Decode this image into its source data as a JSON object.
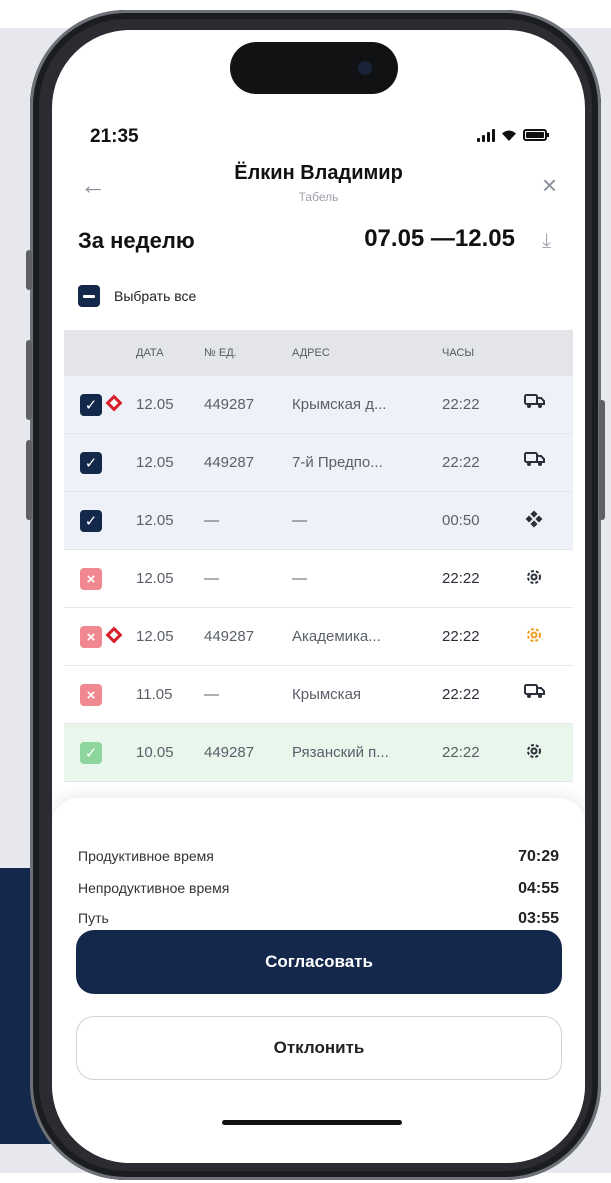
{
  "status": {
    "time": "21:35"
  },
  "header": {
    "title": "Ёлкин Владимир",
    "subtitle": "Табель"
  },
  "period": {
    "label": "За неделю",
    "range": "07.05 —12.05"
  },
  "select_all": {
    "label": "Выбрать все"
  },
  "table": {
    "columns": [
      "ДАТА",
      "№ ЕД.",
      "АДРЕС",
      "ЧАСЫ"
    ],
    "rows": [
      {
        "status": "checked",
        "flag": true,
        "date": "12.05",
        "unit": "449287",
        "address": "Крымская д...",
        "hours": "22:22",
        "icon": "truck-icon"
      },
      {
        "status": "checked",
        "flag": false,
        "date": "12.05",
        "unit": "449287",
        "address": "7-й Предпо...",
        "hours": "22:22",
        "icon": "truck-icon"
      },
      {
        "status": "checked",
        "flag": false,
        "date": "12.05",
        "unit": "—",
        "address": "—",
        "hours": "00:50",
        "icon": "diamond-grid-icon"
      },
      {
        "status": "rejected",
        "flag": false,
        "date": "12.05",
        "unit": "—",
        "address": "—",
        "hours": "22:22",
        "icon": "gear-icon"
      },
      {
        "status": "rejected",
        "flag": true,
        "date": "12.05",
        "unit": "449287",
        "address": "Академика...",
        "hours": "22:22",
        "icon": "gear-orange-icon"
      },
      {
        "status": "rejected",
        "flag": false,
        "date": "11.05",
        "unit": "—",
        "address": "Крымская",
        "hours": "22:22",
        "icon": "truck-icon"
      },
      {
        "status": "approved",
        "flag": false,
        "date": "10.05",
        "unit": "449287",
        "address": "Рязанский п...",
        "hours": "22:22",
        "icon": "gear-icon"
      }
    ]
  },
  "summary": {
    "productive_label": "Продуктивное время",
    "productive_value": "70:29",
    "unproductive_label": "Непродуктивное время",
    "unproductive_value": "04:55",
    "travel_label": "Путь",
    "travel_value": "03:55"
  },
  "actions": {
    "approve_label": "Согласовать",
    "reject_label": "Отклонить"
  },
  "colors": {
    "navy": "#13284a",
    "rejected": "#f08891",
    "approved": "#8ed49d",
    "flag": "#d81e2b",
    "orange": "#f0a020"
  }
}
